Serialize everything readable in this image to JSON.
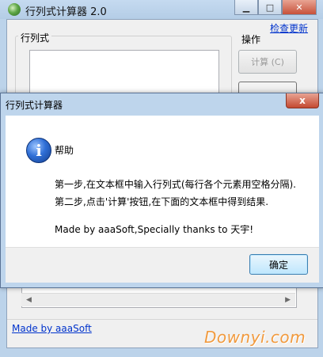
{
  "main_window": {
    "title": "行列式计算器 2.0",
    "check_update_link": "检查更新",
    "input_group_label": "行列式",
    "operation_label": "操作",
    "calc_button": "计算 (C)",
    "made_by_link": "Made by aaaSoft"
  },
  "dialog": {
    "title": "行列式计算器",
    "close_label": "x",
    "heading": "帮助",
    "lines": [
      "第一步,在文本框中输入行列式(每行各个元素用空格分隔).",
      "第二步,点击'计算'按钮,在下面的文本框中得到结果.",
      "Made by aaaSoft,Specially thanks to 天宇!"
    ],
    "ok_button": "确定"
  },
  "watermark": "Downyi.com"
}
